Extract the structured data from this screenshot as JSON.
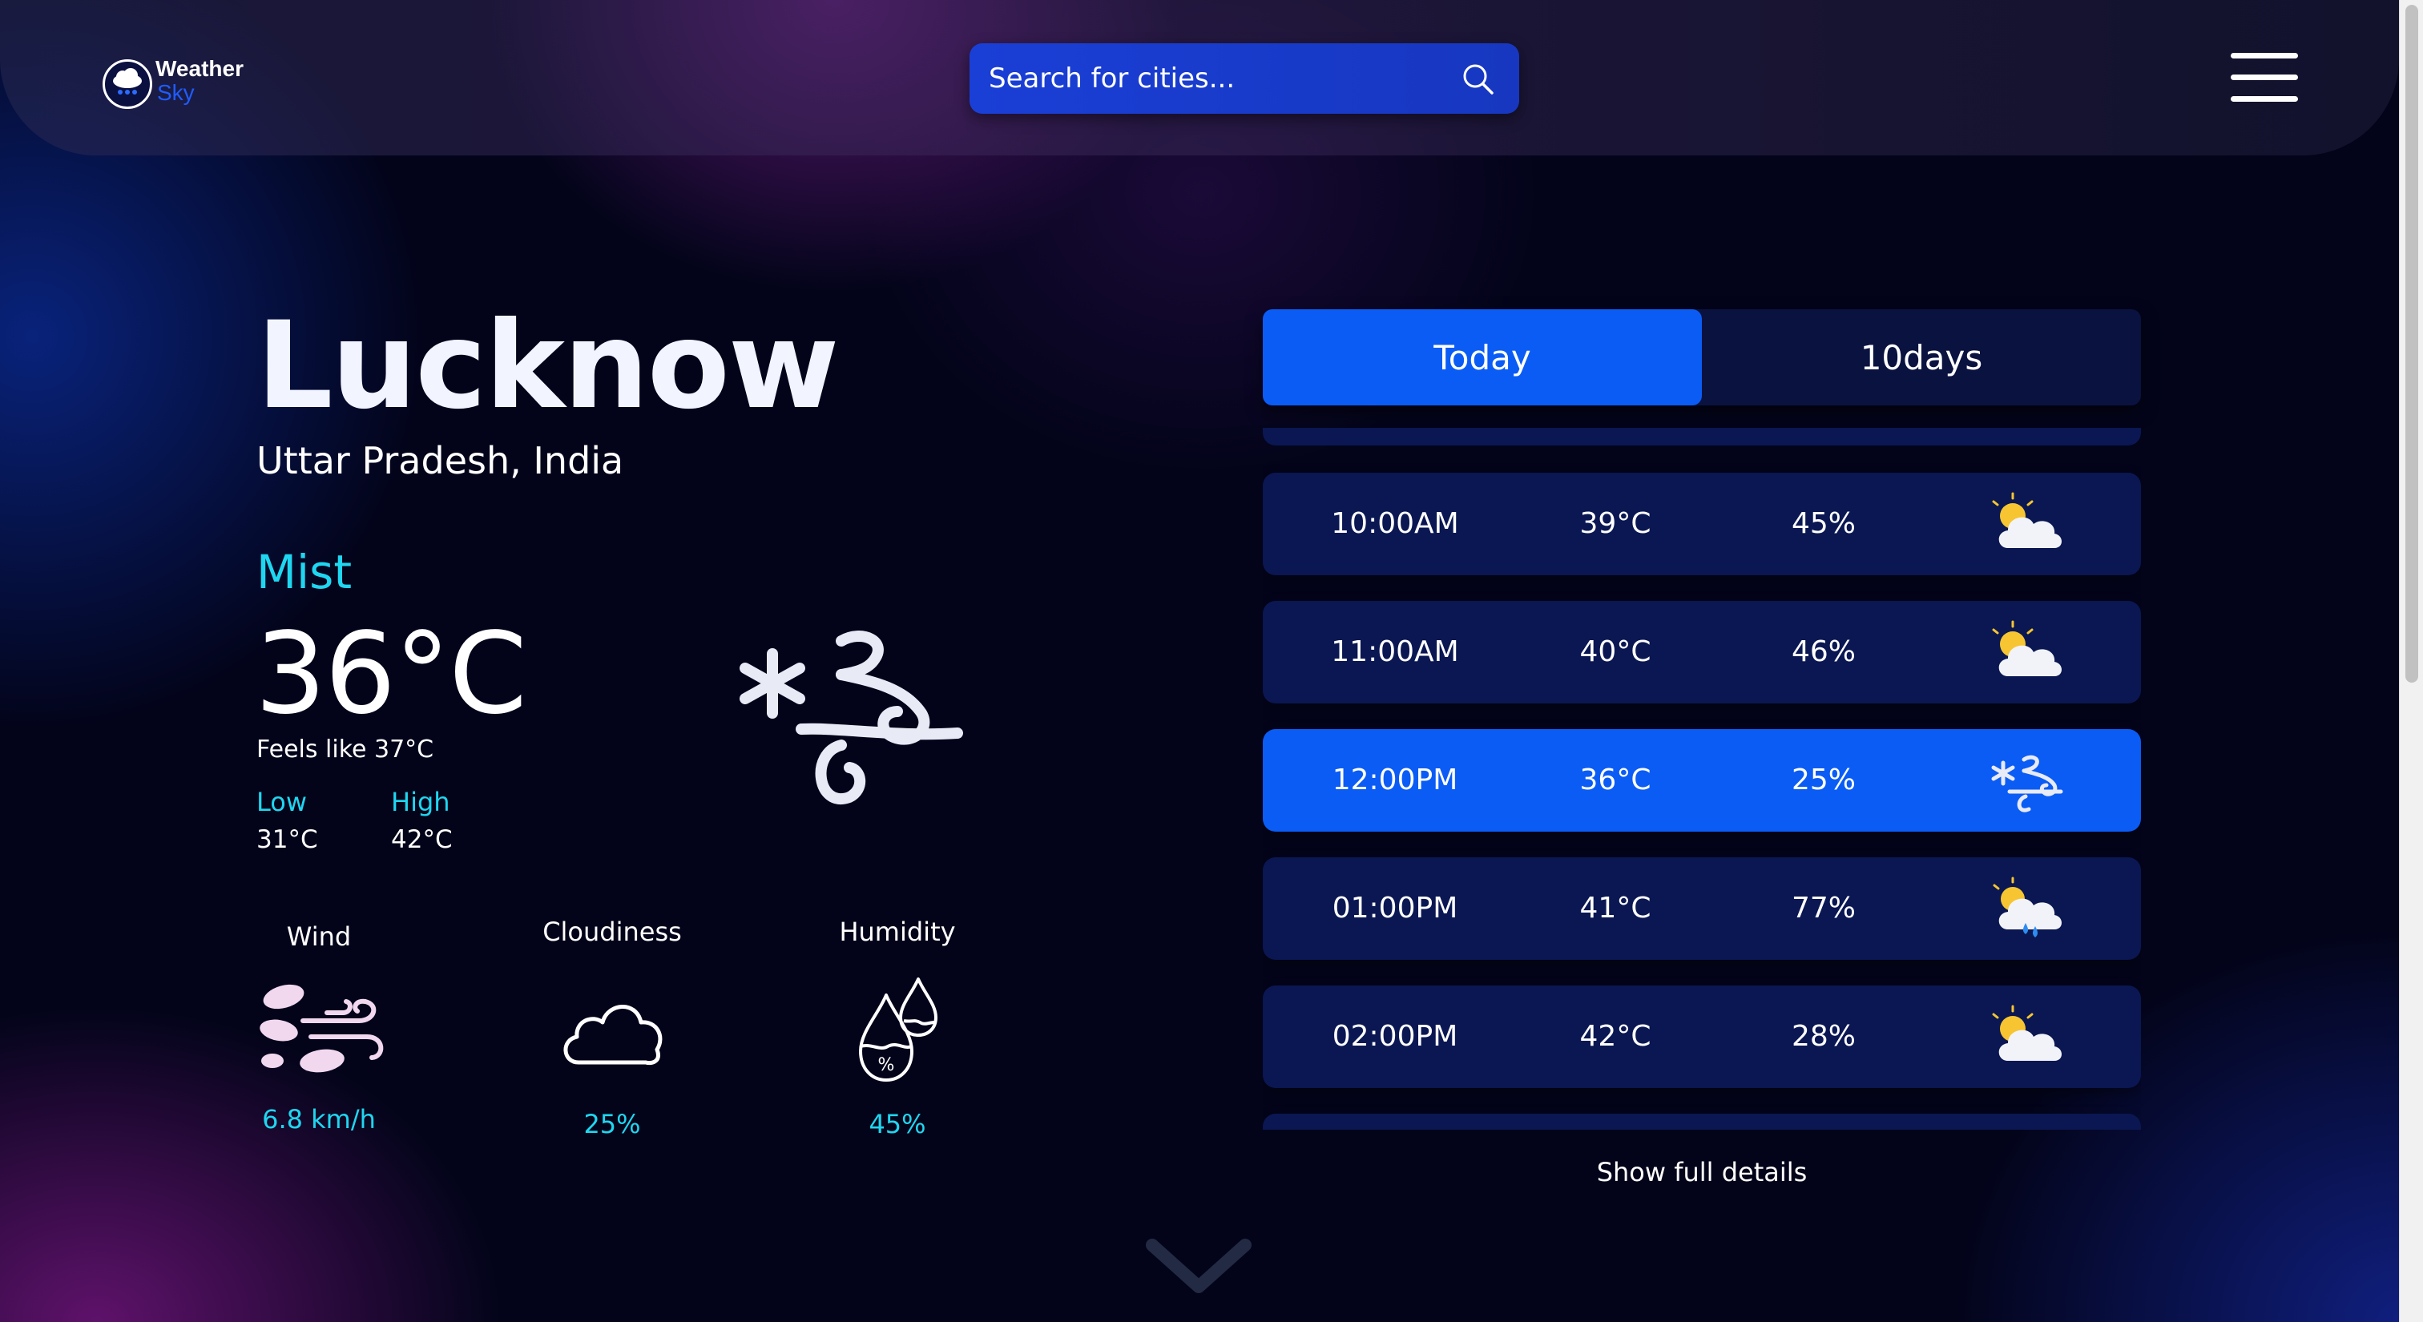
{
  "brand": {
    "title": "Weather",
    "subtitle": "Sky"
  },
  "search": {
    "placeholder": "Search for cities..."
  },
  "current": {
    "city": "Lucknow",
    "region": "Uttar Pradesh, India",
    "condition": "Mist",
    "temperature": "36°C",
    "feels_like": "Feels like 37°C",
    "low_label": "Low",
    "low_value": "31°C",
    "high_label": "High",
    "high_value": "42°C",
    "icon": "mist-wind-icon"
  },
  "stats": [
    {
      "label": "Wind",
      "value": "6.8 km/h",
      "icon": "wind-icon"
    },
    {
      "label": "Cloudiness",
      "value": "25%",
      "icon": "cloud-icon"
    },
    {
      "label": "Humidity",
      "value": "45%",
      "icon": "humidity-drops-icon"
    }
  ],
  "tabs": [
    {
      "label": "Today",
      "active": true
    },
    {
      "label": "10days",
      "active": false
    }
  ],
  "hourly": [
    {
      "time": "10:00AM",
      "temp": "39°C",
      "humidity": "45%",
      "icon": "partly-cloudy-icon",
      "active": false
    },
    {
      "time": "11:00AM",
      "temp": "40°C",
      "humidity": "46%",
      "icon": "partly-cloudy-icon",
      "active": false
    },
    {
      "time": "12:00PM",
      "temp": "36°C",
      "humidity": "25%",
      "icon": "mist-wind-icon",
      "active": true
    },
    {
      "time": "01:00PM",
      "temp": "41°C",
      "humidity": "77%",
      "icon": "partly-cloudy-rain-icon",
      "active": false
    },
    {
      "time": "02:00PM",
      "temp": "42°C",
      "humidity": "28%",
      "icon": "partly-cloudy-icon",
      "active": false
    }
  ],
  "show_full_label": "Show full details",
  "colors": {
    "accent": "#0a5cf5",
    "highlight_text": "#1fd6f0",
    "card": "#0a1752",
    "background": "#03041a"
  }
}
